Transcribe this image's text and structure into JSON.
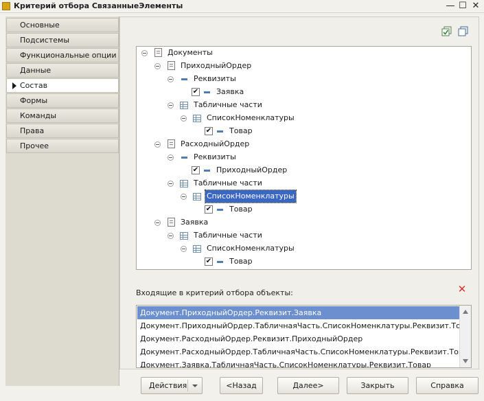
{
  "window": {
    "title": "Критерий отбора СвязанныеЭлементы",
    "controls": {
      "minimize": "—",
      "maximize": "☐",
      "close": "✕"
    }
  },
  "sidebar": {
    "items": [
      {
        "label": "Основные",
        "active": false
      },
      {
        "label": "Подсистемы",
        "active": false
      },
      {
        "label": "Функциональные опции",
        "active": false
      },
      {
        "label": "Данные",
        "active": false
      },
      {
        "label": "Состав",
        "active": true
      },
      {
        "label": "Формы",
        "active": false
      },
      {
        "label": "Команды",
        "active": false
      },
      {
        "label": "Права",
        "active": false
      },
      {
        "label": "Прочее",
        "active": false
      }
    ]
  },
  "toolbar": {
    "icons": [
      "check-all-icon",
      "copy-icon"
    ]
  },
  "tree": {
    "nodes": [
      {
        "label": "Документы",
        "icon": "document-icon",
        "checked": null,
        "selected": false
      },
      {
        "label": "ПриходныйОрдер",
        "icon": "document-icon",
        "checked": null,
        "selected": false
      },
      {
        "label": "Реквизиты",
        "icon": "attribute-icon",
        "checked": null,
        "selected": false
      },
      {
        "label": "Заявка",
        "icon": "attribute-icon",
        "checked": true,
        "selected": false
      },
      {
        "label": "Табличные части",
        "icon": "table-icon",
        "checked": null,
        "selected": false
      },
      {
        "label": "СписокНоменклатуры",
        "icon": "table-icon",
        "checked": null,
        "selected": false
      },
      {
        "label": "Товар",
        "icon": "attribute-icon",
        "checked": true,
        "selected": false
      },
      {
        "label": "РасходныйОрдер",
        "icon": "document-icon",
        "checked": null,
        "selected": false
      },
      {
        "label": "Реквизиты",
        "icon": "attribute-icon",
        "checked": null,
        "selected": false
      },
      {
        "label": "ПриходныйОрдер",
        "icon": "attribute-icon",
        "checked": true,
        "selected": false
      },
      {
        "label": "Табличные части",
        "icon": "table-icon",
        "checked": null,
        "selected": false
      },
      {
        "label": "СписокНоменклатуры",
        "icon": "table-icon",
        "checked": null,
        "selected": true
      },
      {
        "label": "Товар",
        "icon": "attribute-icon",
        "checked": true,
        "selected": false
      },
      {
        "label": "Заявка",
        "icon": "document-icon",
        "checked": null,
        "selected": false
      },
      {
        "label": "Табличные части",
        "icon": "table-icon",
        "checked": null,
        "selected": false
      },
      {
        "label": "СписокНоменклатуры",
        "icon": "table-icon",
        "checked": null,
        "selected": false
      },
      {
        "label": "Товар",
        "icon": "attribute-icon",
        "checked": true,
        "selected": false
      }
    ]
  },
  "incoming": {
    "label": "Входящие в критерий отбора объекты:",
    "delete_icon": "delete-icon",
    "rows": [
      {
        "text": "Документ.ПриходныйОрдер.Реквизит.Заявка",
        "selected": true
      },
      {
        "text": "Документ.ПриходныйОрдер.ТабличнаяЧасть.СписокНоменклатуры.Реквизит.Товар",
        "selected": false
      },
      {
        "text": "Документ.РасходныйОрдер.Реквизит.ПриходныйОрдер",
        "selected": false
      },
      {
        "text": "Документ.РасходныйОрдер.ТабличнаяЧасть.СписокНоменклатуры.Реквизит.Товар",
        "selected": false
      },
      {
        "text": "Документ.Заявка.ТабличнаяЧасть.СписокНоменклатуры.Реквизит.Товар",
        "selected": false
      }
    ]
  },
  "buttons": {
    "actions": "Действия",
    "back": "<Назад",
    "next": "Далее>",
    "close": "Закрыть",
    "help": "Справка"
  }
}
